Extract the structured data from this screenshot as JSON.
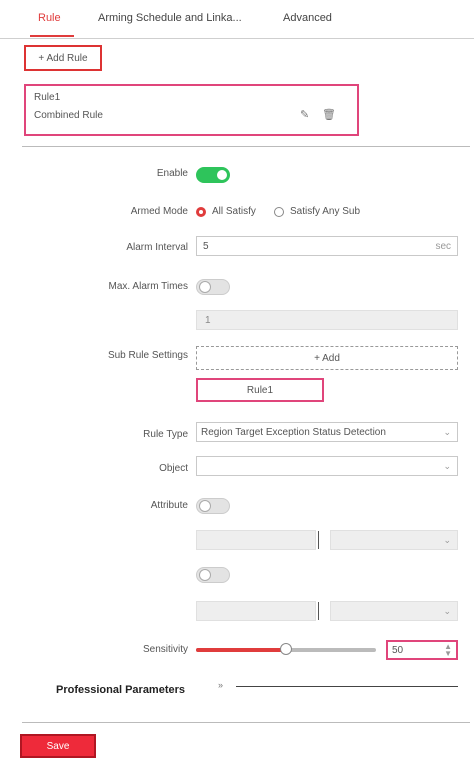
{
  "tabs": [
    {
      "label": "Rule",
      "active": true
    },
    {
      "label": "Arming Schedule and Linka..."
    },
    {
      "label": "Advanced"
    }
  ],
  "add_rule": {
    "icon": "plus-icon",
    "label": "+ Add Rule"
  },
  "rules": {
    "header": "Rule1",
    "item_label": "Combined Rule",
    "edit_icon": "edit-icon",
    "delete_icon": "delete-icon"
  },
  "form": {
    "enable": {
      "label": "Enable",
      "value": true
    },
    "schedule_mode": {
      "label": "Armed Mode",
      "options": [
        "All Satisfy",
        "Satisfy Any Sub"
      ],
      "selected": 0
    },
    "alarm_interval": {
      "label": "Alarm Interval",
      "value": "5",
      "unit": "sec"
    },
    "max_alarm_times": {
      "label": "Max. Alarm Times",
      "value": false,
      "disabled_value": "1"
    },
    "sub_rule_settings": {
      "label": "Sub Rule Settings",
      "add_label": "+ Add"
    },
    "rule_chip": "Rule1",
    "rule_type": {
      "label": "Rule Type",
      "value": "Region Target Exception Status Detection"
    },
    "object": {
      "label": "Object",
      "value": ""
    },
    "attribute": {
      "label": "Attribute",
      "value": false
    },
    "attribute2": {
      "value": false
    },
    "sensitivity": {
      "label": "Sensitivity",
      "value": 50,
      "max": 100,
      "display": "50"
    },
    "professional_parameters": "Professional Parameters"
  },
  "save_label": "Save",
  "colors": {
    "accent": "#e03c3c",
    "toggle_on": "#2ec45b",
    "highlight": "#e0457b"
  }
}
